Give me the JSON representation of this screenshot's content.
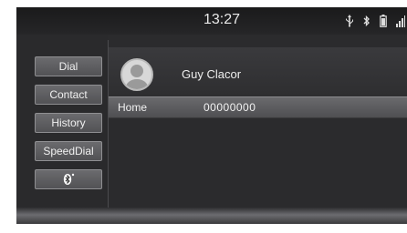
{
  "status_bar": {
    "time": "13:27",
    "icons": [
      "usb-icon",
      "bluetooth-icon",
      "battery-icon",
      "signal-icon"
    ]
  },
  "sidebar": {
    "items": [
      {
        "label": "Dial"
      },
      {
        "label": "Contact"
      },
      {
        "label": "History"
      },
      {
        "label": "SpeedDial"
      },
      {
        "label": "",
        "icon": "bluetooth-icon"
      }
    ]
  },
  "contact": {
    "name": "Guy Clacor",
    "avatar_icon": "person-avatar-icon",
    "numbers": [
      {
        "type": "Home",
        "number": "00000000"
      }
    ]
  },
  "colors": {
    "screen_bg": "#2b2b2d",
    "button_bg": "#5e5e61",
    "selected_row": "#5b5b5e"
  }
}
